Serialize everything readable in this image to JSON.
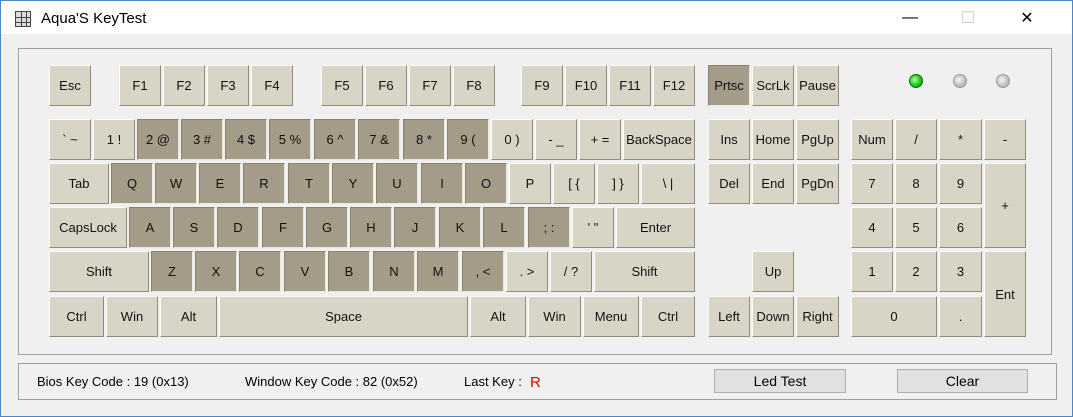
{
  "title": "Aqua'S KeyTest",
  "window": {
    "minimize": "—",
    "maximize": "☐",
    "close": "✕"
  },
  "icons": {
    "app": "keyboard-grid-icon",
    "led_on_color": "#22d01c",
    "led_off_color": "#c4c4c4"
  },
  "keys": {
    "esc": "Esc",
    "f1": "F1",
    "f2": "F2",
    "f3": "F3",
    "f4": "F4",
    "f5": "F5",
    "f6": "F6",
    "f7": "F7",
    "f8": "F8",
    "f9": "F9",
    "f10": "F10",
    "f11": "F11",
    "f12": "F12",
    "prtsc": "Prtsc",
    "scrlk": "ScrLk",
    "pause": "Pause",
    "grave": "` ~",
    "k1": "1 !",
    "k2": "2 @",
    "k3": "3 #",
    "k4": "4 $",
    "k5": "5 %",
    "k6": "6 ^",
    "k7": "7 &",
    "k8": "8 *",
    "k9": "9 (",
    "k0": "0 )",
    "minus": "- _",
    "equals": "+ =",
    "backspace": "BackSpace",
    "tab": "Tab",
    "q": "Q",
    "w": "W",
    "e": "E",
    "r": "R",
    "t": "T",
    "y": "Y",
    "u": "U",
    "i": "I",
    "o": "O",
    "p": "P",
    "lbracket": "[ {",
    "rbracket": "] }",
    "backslash": "\\ |",
    "capslock": "CapsLock",
    "a": "A",
    "s": "S",
    "d": "D",
    "f": "F",
    "g": "G",
    "h": "H",
    "j": "J",
    "k": "K",
    "l": "L",
    "semicolon": "; :",
    "quote": "' \"",
    "enter": "Enter",
    "lshift": "Shift",
    "z": "Z",
    "x": "X",
    "c": "C",
    "v": "V",
    "b": "B",
    "n": "N",
    "m": "M",
    "comma": ", <",
    "period": ". >",
    "slash": "/ ?",
    "rshift": "Shift",
    "lctrl": "Ctrl",
    "lwin": "Win",
    "lalt": "Alt",
    "space": "Space",
    "ralt": "Alt",
    "rwin": "Win",
    "menu": "Menu",
    "rctrl": "Ctrl",
    "ins": "Ins",
    "home": "Home",
    "pgup": "PgUp",
    "del": "Del",
    "end": "End",
    "pgdn": "PgDn",
    "up": "Up",
    "left": "Left",
    "down": "Down",
    "right": "Right",
    "num": "Num",
    "np_slash": "/",
    "np_star": "*",
    "np_minus": "-",
    "np7": "7",
    "np8": "8",
    "np9": "9",
    "np_plus": "+",
    "np4": "4",
    "np5": "5",
    "np6": "6",
    "np1": "1",
    "np2": "2",
    "np3": "3",
    "np_enter": "Ent",
    "np0": "0",
    "np_dot": "."
  },
  "status": {
    "bios_label": "Bios Key Code : 19 (0x13)",
    "window_label": "Window Key Code : 82 (0x52)",
    "lastkey_label": "Last Key :",
    "lastkey_value": "R",
    "led_test": "Led Test",
    "clear": "Clear"
  }
}
